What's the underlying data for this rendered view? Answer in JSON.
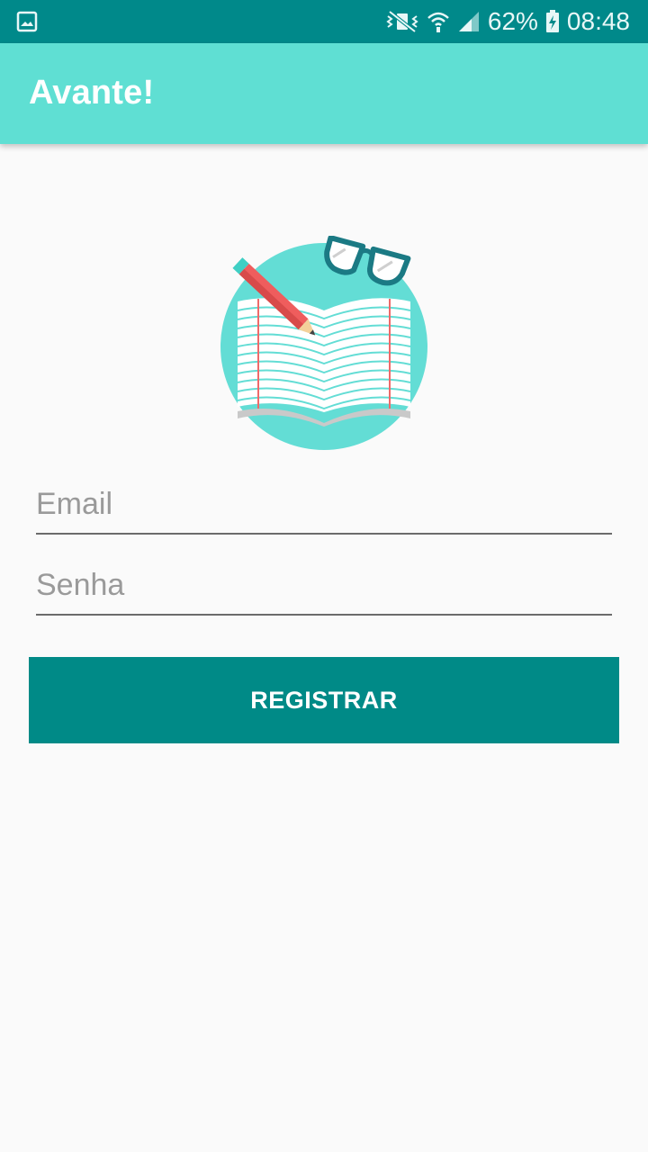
{
  "status_bar": {
    "battery_text": "62%",
    "time": "08:48",
    "icons": [
      "gallery-icon",
      "mute-vibrate-icon",
      "wifi-icon",
      "signal-icon",
      "battery-charging-icon"
    ]
  },
  "app_bar": {
    "title": "Avante!",
    "color": "#5fdfd3"
  },
  "logo": {
    "icon": "open-book-with-pencil-and-glasses-icon"
  },
  "form": {
    "email_placeholder": "Email",
    "password_placeholder": "Senha",
    "register_label": "REGISTRAR"
  },
  "colors": {
    "status_bar": "#00898a",
    "accent": "#008a87",
    "logo_circle": "#63ddd5",
    "background": "#fafafa"
  }
}
